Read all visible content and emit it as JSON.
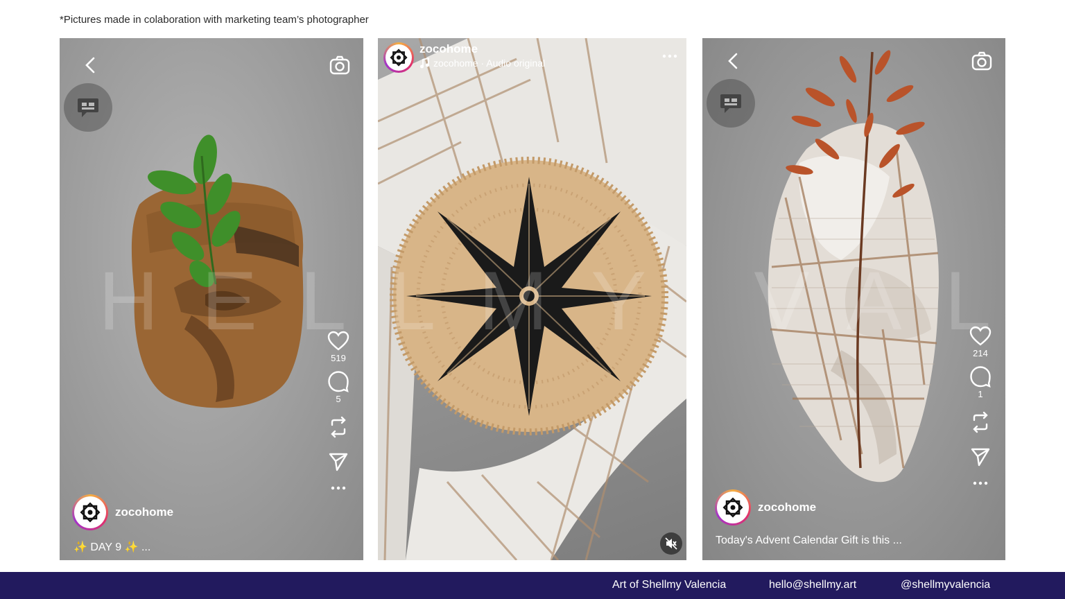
{
  "note": "*Pictures made in colaboration  with marketing team’s photographer",
  "watermark": "SHELLMY VALENCIA",
  "phones": [
    {
      "account": "zocohome",
      "likes": "519",
      "comments": "5",
      "caption": "✨ DAY 9 ✨  ..."
    },
    {
      "account": "zocohome",
      "audio": "zocohome · Audio original"
    },
    {
      "account": "zocohome",
      "likes": "214",
      "comments": "1",
      "caption": "Today's Advent Calendar Gift is this ..."
    }
  ],
  "footer": {
    "name": "Art of Shellmy Valencia",
    "email": "hello@shellmy.art",
    "handle": "@shellmyvalencia"
  },
  "colors": {
    "footer_bg": "#221a5e",
    "ring_gradient": "#e1306c"
  },
  "icons": [
    "back-icon",
    "camera-icon",
    "chat-bubble-icon",
    "heart-icon",
    "comment-icon",
    "repost-icon",
    "send-icon",
    "more-icon",
    "music-note-icon",
    "mute-icon"
  ]
}
